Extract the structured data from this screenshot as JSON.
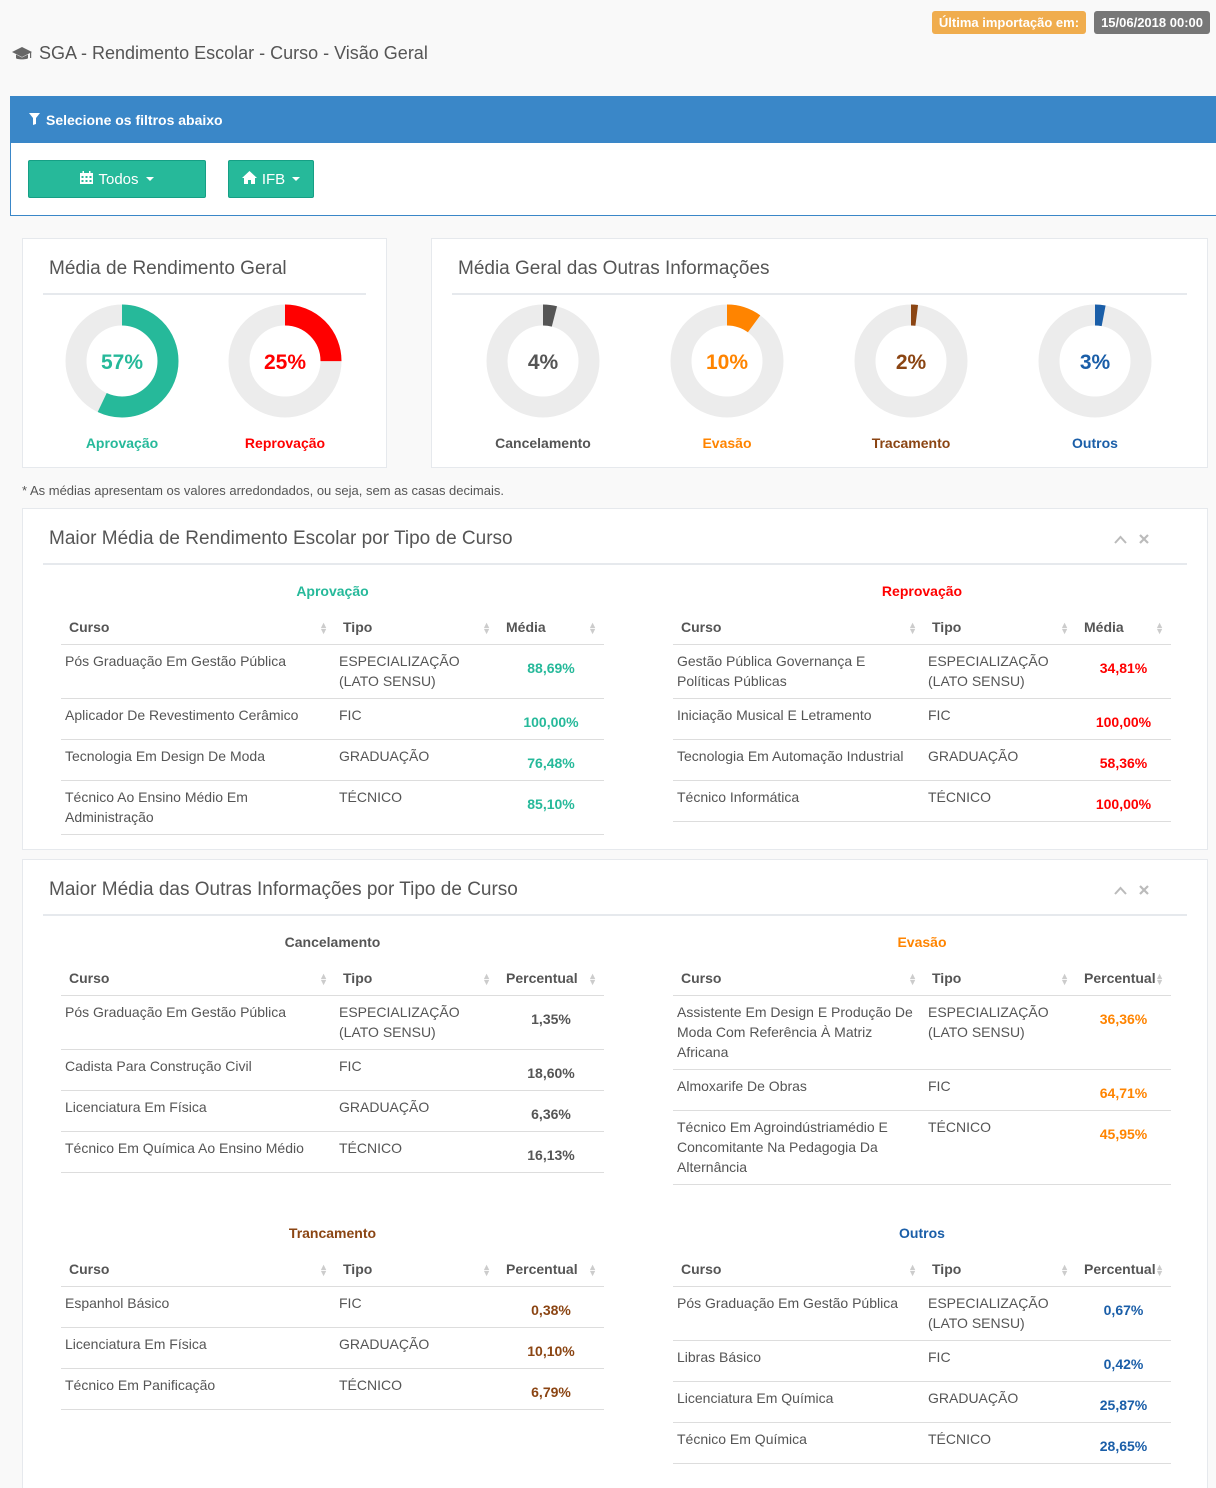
{
  "header": {
    "import_label": "Última importação em:",
    "import_date": "15/06/2018 00:00",
    "title": "SGA - Rendimento Escolar - Curso - Visão Geral"
  },
  "filters": {
    "title": "Selecione os filtros abaixo",
    "period_button": "Todos",
    "institution_button": "IFB"
  },
  "colors": {
    "aprovacao": "#26b99a",
    "reprovacao": "#ff0000",
    "cancelamento": "#555555",
    "evasao": "#ff8400",
    "trancamento": "#8b4513",
    "outros": "#1a5ea8"
  },
  "geral": {
    "title": "Média de Rendimento Geral",
    "donuts": [
      {
        "pct_text": "57%",
        "value": 57,
        "label": "Aprovação",
        "key": "aprovacao"
      },
      {
        "pct_text": "25%",
        "value": 25,
        "label": "Reprovação",
        "key": "reprovacao"
      }
    ]
  },
  "outras": {
    "title": "Média Geral das Outras Informações",
    "donuts": [
      {
        "pct_text": "4%",
        "value": 4,
        "label": "Cancelamento",
        "key": "cancelamento"
      },
      {
        "pct_text": "10%",
        "value": 10,
        "label": "Evasão",
        "key": "evasao"
      },
      {
        "pct_text": "2%",
        "value": 2,
        "label": "Tracamento",
        "key": "trancamento"
      },
      {
        "pct_text": "3%",
        "value": 3,
        "label": "Outros",
        "key": "outros"
      }
    ]
  },
  "note": "* As médias apresentam os valores arredondados, ou seja, sem as casas decimais.",
  "rendimento": {
    "title": "Maior Média de Rendimento Escolar por Tipo de Curso",
    "tables": [
      {
        "caption": "Aprovação",
        "key": "aprovacao",
        "headers": [
          "Curso",
          "Tipo",
          "Média"
        ],
        "rows": [
          [
            "Pós Graduação Em Gestão Pública",
            "ESPECIALIZAÇÃO (LATO SENSU)",
            "88,69%"
          ],
          [
            "Aplicador De Revestimento Cerâmico",
            "FIC",
            "100,00%"
          ],
          [
            "Tecnologia Em Design De Moda",
            "GRADUAÇÃO",
            "76,48%"
          ],
          [
            "Técnico Ao Ensino Médio Em Administração",
            "TÉCNICO",
            "85,10%"
          ]
        ]
      },
      {
        "caption": "Reprovação",
        "key": "reprovacao",
        "headers": [
          "Curso",
          "Tipo",
          "Média"
        ],
        "rows": [
          [
            "Gestão Pública Governança E Políticas Públicas",
            "ESPECIALIZAÇÃO (LATO SENSU)",
            "34,81%"
          ],
          [
            "Iniciação Musical E Letramento",
            "FIC",
            "100,00%"
          ],
          [
            "Tecnologia Em Automação Industrial",
            "GRADUAÇÃO",
            "58,36%"
          ],
          [
            "Técnico Informática",
            "TÉCNICO",
            "100,00%"
          ]
        ]
      }
    ]
  },
  "outras_tipo": {
    "title": "Maior Média das Outras Informações por Tipo de Curso",
    "tables": [
      {
        "caption": "Cancelamento",
        "key": "cancelamento",
        "headers": [
          "Curso",
          "Tipo",
          "Percentual"
        ],
        "rows": [
          [
            "Pós Graduação Em Gestão Pública",
            "ESPECIALIZAÇÃO (LATO SENSU)",
            "1,35%"
          ],
          [
            "Cadista Para Construção Civil",
            "FIC",
            "18,60%"
          ],
          [
            "Licenciatura Em Física",
            "GRADUAÇÃO",
            "6,36%"
          ],
          [
            "Técnico Em Química Ao Ensino Médio",
            "TÉCNICO",
            "16,13%"
          ]
        ]
      },
      {
        "caption": "Evasão",
        "key": "evasao",
        "headers": [
          "Curso",
          "Tipo",
          "Percentual"
        ],
        "rows": [
          [
            "Assistente Em Design E Produção De Moda Com Referência À Matriz Africana",
            "ESPECIALIZAÇÃO (LATO SENSU)",
            "36,36%"
          ],
          [
            "Almoxarife De Obras",
            "FIC",
            "64,71%"
          ],
          [
            "Técnico Em Agroindústriamédio E Concomitante Na Pedagogia Da Alternância",
            "TÉCNICO",
            "45,95%"
          ]
        ]
      },
      {
        "caption": "Trancamento",
        "key": "trancamento",
        "headers": [
          "Curso",
          "Tipo",
          "Percentual"
        ],
        "rows": [
          [
            "Espanhol Básico",
            "FIC",
            "0,38%"
          ],
          [
            "Licenciatura Em Física",
            "GRADUAÇÃO",
            "10,10%"
          ],
          [
            "Técnico Em Panificação",
            "TÉCNICO",
            "6,79%"
          ]
        ]
      },
      {
        "caption": "Outros",
        "key": "outros",
        "headers": [
          "Curso",
          "Tipo",
          "Percentual"
        ],
        "rows": [
          [
            "Pós Graduação Em Gestão Pública",
            "ESPECIALIZAÇÃO (LATO SENSU)",
            "0,67%"
          ],
          [
            "Libras Básico",
            "FIC",
            "0,42%"
          ],
          [
            "Licenciatura Em Química",
            "GRADUAÇÃO",
            "25,87%"
          ],
          [
            "Técnico Em Química",
            "TÉCNICO",
            "28,65%"
          ]
        ]
      }
    ]
  }
}
